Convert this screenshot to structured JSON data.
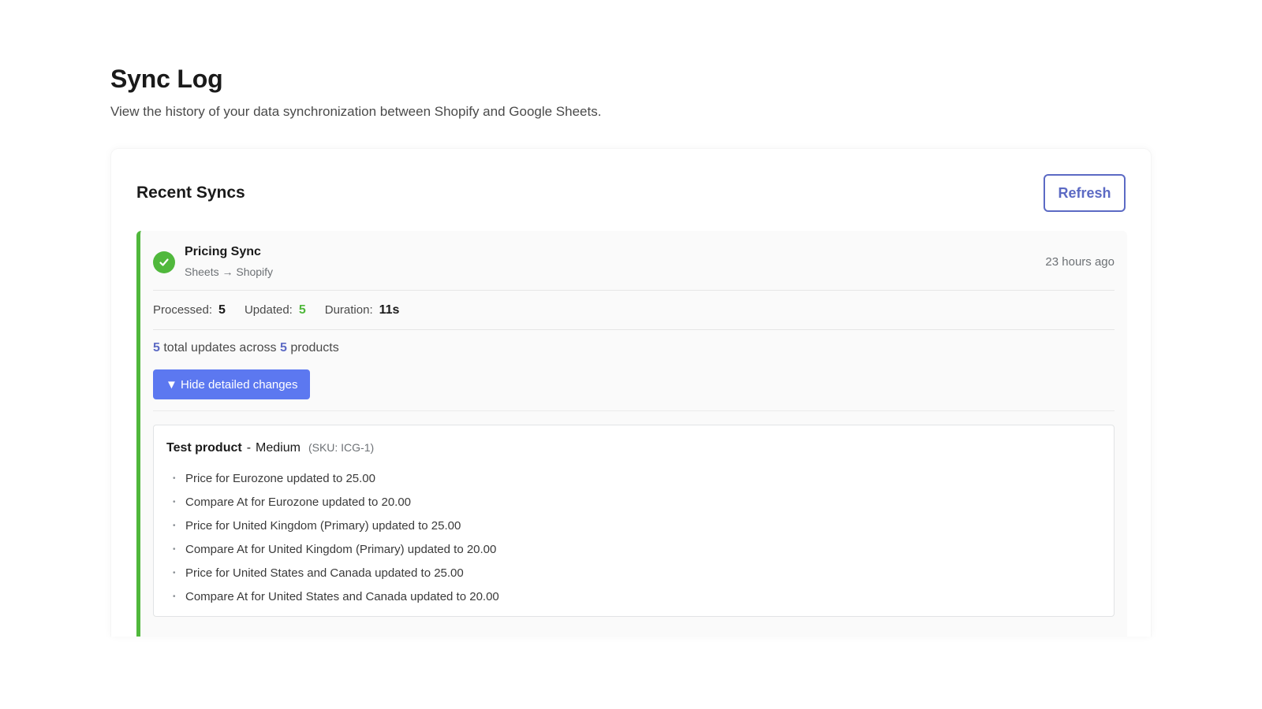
{
  "header": {
    "title": "Sync Log",
    "subtitle": "View the history of your data synchronization between Shopify and Google Sheets."
  },
  "card": {
    "title": "Recent Syncs",
    "refresh_label": "Refresh"
  },
  "sync": {
    "name": "Pricing Sync",
    "direction": "Sheets → Shopify",
    "time": "23 hours ago",
    "status": "success",
    "status_icon": "check-icon",
    "colors": {
      "success": "#50b83c",
      "accent": "#5c6ac4",
      "button": "#5c78f0"
    },
    "stats": {
      "processed_label": "Processed:",
      "processed_value": "5",
      "updated_label": "Updated:",
      "updated_value": "5",
      "duration_label": "Duration:",
      "duration_value": "11s"
    },
    "summary": {
      "updates": "5",
      "text_mid": " total updates across ",
      "products": "5",
      "text_end": " products"
    },
    "toggle_label": "▼ Hide detailed changes",
    "product": {
      "name": "Test product",
      "separator": "-",
      "variant": "Medium",
      "sku": "(SKU: ICG-1)"
    },
    "changes": [
      "Price for Eurozone updated to 25.00",
      "Compare At for Eurozone updated to 20.00",
      "Price for United Kingdom (Primary) updated to 25.00",
      "Compare At for United Kingdom (Primary) updated to 20.00",
      "Price for United States and Canada updated to 25.00",
      "Compare At for United States and Canada updated to 20.00"
    ]
  }
}
